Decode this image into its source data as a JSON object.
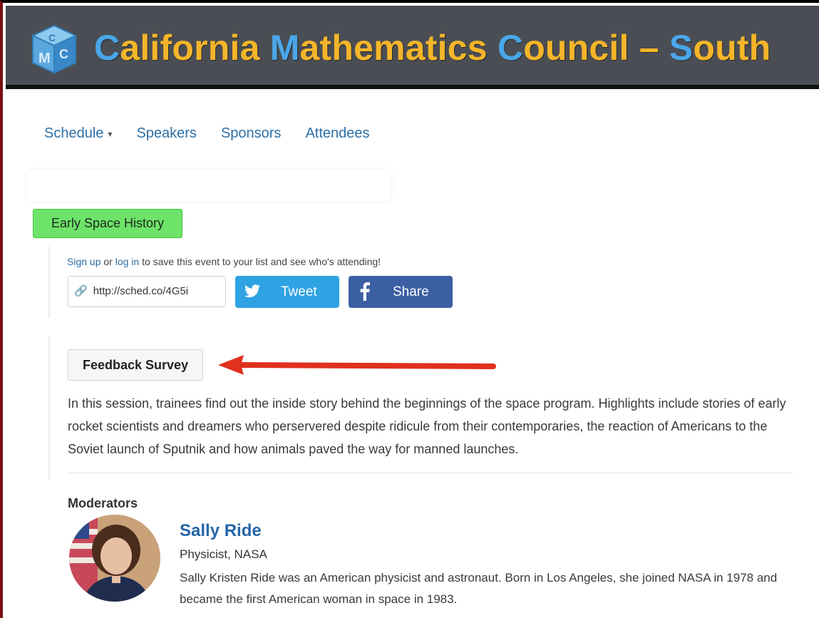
{
  "header": {
    "logo_alt": "CMC",
    "title_parts": [
      {
        "text": "C",
        "cap": true
      },
      {
        "text": "alifornia ",
        "cap": false
      },
      {
        "text": "M",
        "cap": true
      },
      {
        "text": "athematics ",
        "cap": false
      },
      {
        "text": "C",
        "cap": true
      },
      {
        "text": "ouncil – ",
        "cap": false
      },
      {
        "text": "S",
        "cap": true
      },
      {
        "text": "outh",
        "cap": false
      }
    ],
    "colors": {
      "banner": "#4a4e54",
      "title": "#f4b52a",
      "caps": "#4aa6e8"
    }
  },
  "nav": {
    "items": [
      {
        "label": "Schedule",
        "has_dropdown": true
      },
      {
        "label": "Speakers",
        "has_dropdown": false
      },
      {
        "label": "Sponsors",
        "has_dropdown": false
      },
      {
        "label": "Attendees",
        "has_dropdown": false
      }
    ],
    "caret": "▾"
  },
  "event": {
    "tag": "Early Space History",
    "signup": {
      "sign_up": "Sign up",
      "or": " or ",
      "log_in": "log in",
      "rest": " to save this event to your list and see who's attending!"
    },
    "short_url": "http://sched.co/4G5i",
    "tweet_label": "Tweet",
    "share_label": "Share",
    "feedback_label": "Feedback Survey",
    "description": "In this session, trainees find out the inside story behind the beginnings of the space program. Highlights include stories of early rocket scientists and dreamers who perservered despite ridicule from their contemporaries, the reaction of Americans to the Soviet launch of Sputnik and how animals paved the way for manned launches."
  },
  "moderators": {
    "heading": "Moderators",
    "people": [
      {
        "name": "Sally Ride",
        "title": "Physicist, NASA",
        "bio": "Sally Kristen Ride was an American physicist and astronaut. Born in Los Angeles, she joined NASA in 1978 and became the first American woman in space in 1983."
      }
    ]
  },
  "icons": {
    "link": "link-icon",
    "twitter": "twitter-bird-icon",
    "facebook": "facebook-f-icon",
    "arrow": "red-arrow-annotation"
  }
}
